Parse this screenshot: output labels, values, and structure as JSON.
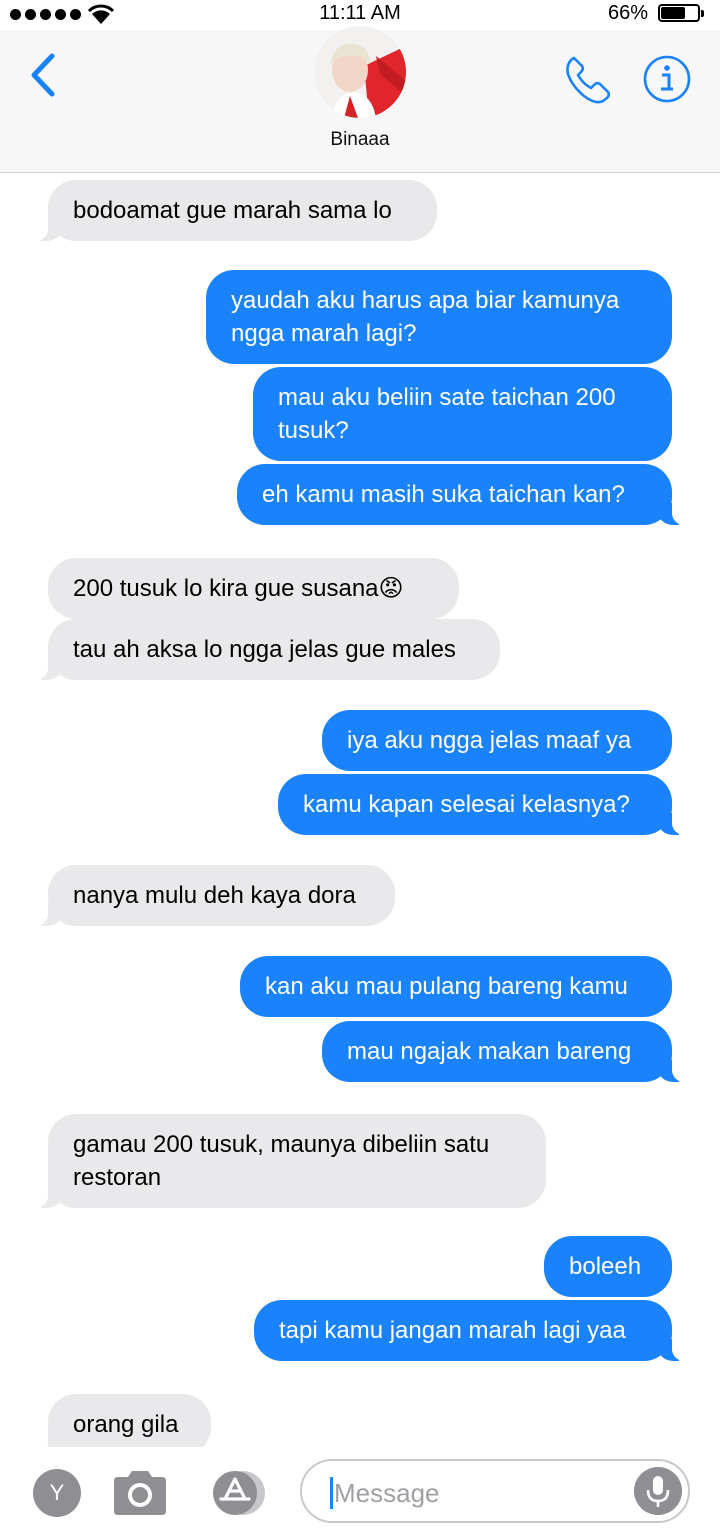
{
  "status_bar": {
    "time": "11:11 AM",
    "battery_percent": "66%",
    "battery_level": 0.66,
    "signal_bars": 5
  },
  "header": {
    "contact_name": "Binaaa",
    "back_icon": "chevron-left-icon",
    "call_icon": "phone-icon",
    "info_icon": "info-icon"
  },
  "colors": {
    "accent": "#1a82fb",
    "incoming_bubble": "#e9e9eb",
    "outgoing_text": "#ffffff"
  },
  "messages": [
    {
      "direction": "in",
      "text": "bodoamat gue marah sama lo"
    },
    {
      "direction": "out",
      "text": "yaudah aku harus apa biar kamunya\nngga marah lagi?"
    },
    {
      "direction": "out",
      "text": "mau aku beliin sate taichan 200\ntusuk?"
    },
    {
      "direction": "out",
      "text": "eh kamu masih suka taichan kan?"
    },
    {
      "direction": "in",
      "text": "200 tusuk lo kira gue susana😡"
    },
    {
      "direction": "in",
      "text": "tau ah aksa lo ngga jelas gue males"
    },
    {
      "direction": "out",
      "text": "iya aku ngga jelas maaf ya"
    },
    {
      "direction": "out",
      "text": "kamu kapan selesai kelasnya?"
    },
    {
      "direction": "in",
      "text": "nanya mulu deh kaya dora"
    },
    {
      "direction": "out",
      "text": "kan aku mau pulang bareng kamu"
    },
    {
      "direction": "out",
      "text": "mau ngajak makan bareng"
    },
    {
      "direction": "in",
      "text": "gamau 200 tusuk, maunya dibeliin satu\nrestoran"
    },
    {
      "direction": "out",
      "text": "boleeh"
    },
    {
      "direction": "out",
      "text": "tapi kamu jangan marah lagi yaa"
    },
    {
      "direction": "in",
      "text": "orang gila"
    }
  ],
  "input_bar": {
    "app_button_label": "Y",
    "placeholder": "Message",
    "camera_icon": "camera-icon",
    "appstore_icon": "app-store-icon",
    "mic_icon": "microphone-icon"
  }
}
